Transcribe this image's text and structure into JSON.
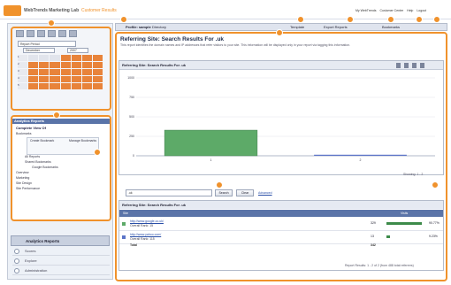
{
  "app": {
    "title": "WebTrends Marketing Lab",
    "subtitle": "Customer Results"
  },
  "header_links": [
    "My WebTrends",
    "Customer Center",
    "Help",
    "Logout"
  ],
  "toolbar": {
    "profile_label": "Profile: sample",
    "profile_value": "Directory",
    "template_label": "Template",
    "export_label": "Export Reports",
    "bookmarks_label": "Bookmarks"
  },
  "calendar": {
    "period_select": "Report Period",
    "month": "December",
    "year": "2007",
    "weeks": [
      "1",
      "2",
      "3",
      "4",
      "5"
    ]
  },
  "reports": {
    "header": "Analytics Reports",
    "complete_view": "Complete View Of",
    "tree": [
      "Bookmarks",
      "Create Bookmark",
      "Manage Bookmarks",
      "All Reports",
      "Shared Bookmarks",
      "Google Bookmarks",
      "Overview",
      "Marketing",
      "Site Design",
      "Site Performance"
    ]
  },
  "nav": {
    "analytics": "Analytics Reports",
    "items": [
      "Scores",
      "Explore",
      "Administration"
    ]
  },
  "main": {
    "title": "Referring Site: Search Results For .uk",
    "description": "This report identifies the domain names and IP addresses that refer visitors to your site. This information will be displayed only in your report via tagging this information.",
    "chart_title": "Referring Site: Search Results For .uk",
    "showing": "Showing: 1 - 2",
    "search_value": ".uk",
    "search_button": "Search",
    "clear_button": "Clear",
    "advanced_link": "Advanced",
    "table_title": "Referring Site: Search Results For .uk",
    "col_site": "Site",
    "col_visits": "Visits",
    "rows": [
      {
        "site": "http://www.google.co.uk/",
        "sub": "Overall Rank: 15",
        "visits": "329",
        "pct": "90.77%",
        "share": 0.9077
      },
      {
        "site": "http://www.yahoo.com/",
        "sub": "Overall Rank: 115",
        "visits": "13",
        "pct": "9.23%",
        "share": 0.0923
      }
    ],
    "total_label": "Total",
    "total_value": "342",
    "footer": "Report Results: 1 - 2 of 2 (from 488 total referrers)"
  },
  "colors": {
    "accent": "#f0922c",
    "bar_primary": "#5daa68",
    "bar_secondary": "#5b74c8",
    "header_blue": "#5b74a8"
  },
  "badges": [
    "1",
    "2",
    "3",
    "4",
    "5",
    "6",
    "7",
    "8",
    "9",
    "10",
    "11",
    "12",
    "13",
    "14"
  ],
  "chart_data": {
    "type": "bar",
    "title": "",
    "categories": [
      "1",
      "2"
    ],
    "values": [
      329,
      13
    ],
    "ylim": [
      0,
      1000
    ],
    "yticks": [
      "1000",
      "750",
      "500",
      "250",
      "0"
    ],
    "grid": true
  }
}
